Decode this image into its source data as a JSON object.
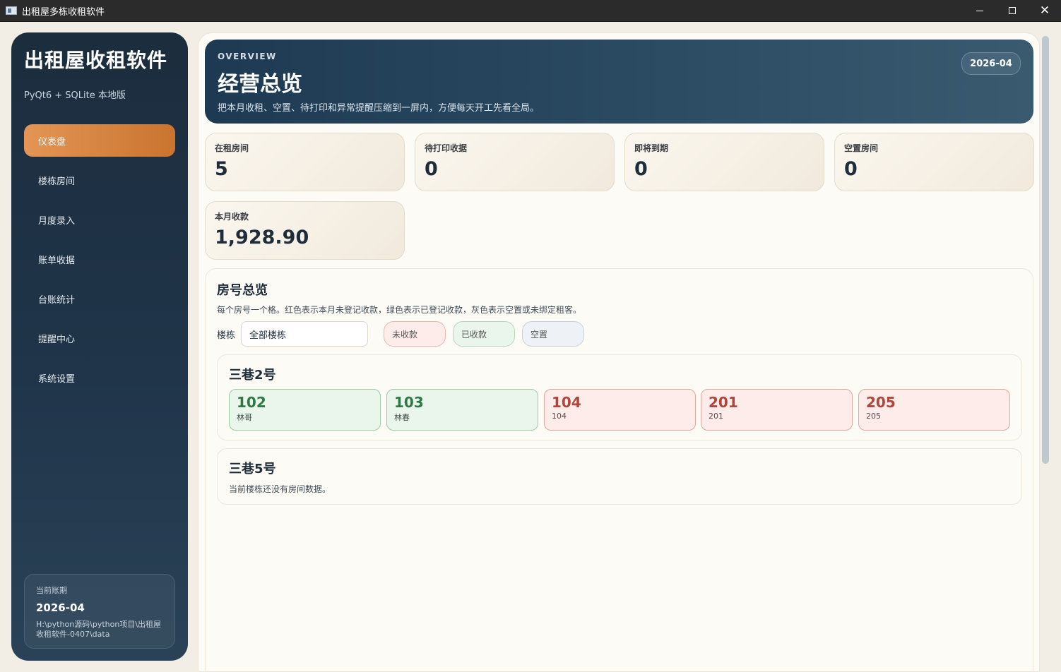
{
  "window": {
    "title": "出租屋多栋收租软件",
    "controls": {
      "minimize": "minimize-icon",
      "maximize": "maximize-icon",
      "close": "close-icon"
    }
  },
  "sidebar": {
    "brand": "出租屋收租软件",
    "subtitle": "PyQt6 + SQLite 本地版",
    "items": [
      {
        "label": "仪表盘",
        "active": true
      },
      {
        "label": "楼栋房间",
        "active": false
      },
      {
        "label": "月度录入",
        "active": false
      },
      {
        "label": "账单收据",
        "active": false
      },
      {
        "label": "台账统计",
        "active": false
      },
      {
        "label": "提醒中心",
        "active": false
      },
      {
        "label": "系统设置",
        "active": false
      }
    ],
    "period": {
      "label": "当前账期",
      "value": "2026-04",
      "path": "H:\\python源码\\python项目\\出租屋收租软件-0407\\data"
    }
  },
  "hero": {
    "eyebrow": "OVERVIEW",
    "title": "经营总览",
    "desc": "把本月收租、空置、待打印和异常提醒压缩到一屏内，方便每天开工先看全局。",
    "month": "2026-04"
  },
  "stats": [
    {
      "label": "在租房间",
      "value": "5"
    },
    {
      "label": "待打印收据",
      "value": "0"
    },
    {
      "label": "即将到期",
      "value": "0"
    },
    {
      "label": "空置房间",
      "value": "0"
    },
    {
      "label": "本月收款",
      "value": "1,928.90"
    }
  ],
  "rooms": {
    "title": "房号总览",
    "desc": "每个房号一个格。红色表示本月未登记收款，绿色表示已登记收款，灰色表示空置或未绑定租客。",
    "filter_label": "楼栋",
    "filter_value": "全部楼栋",
    "legend": {
      "unpaid": "未收款",
      "paid": "已收款",
      "vacant": "空置"
    },
    "buildings": [
      {
        "name": "三巷2号",
        "rooms": [
          {
            "no": "102",
            "tenant": "林哥",
            "status": "paid"
          },
          {
            "no": "103",
            "tenant": "林春",
            "status": "paid"
          },
          {
            "no": "104",
            "tenant": "104",
            "status": "unpaid"
          },
          {
            "no": "201",
            "tenant": "201",
            "status": "unpaid"
          },
          {
            "no": "205",
            "tenant": "205",
            "status": "unpaid"
          }
        ]
      },
      {
        "name": "三巷5号",
        "empty_msg": "当前楼栋还没有房间数据。"
      }
    ],
    "colors": {
      "paid": "#2f7a44",
      "unpaid": "#b0453b",
      "accent": "#d98340",
      "hero": "#1e3a52"
    }
  }
}
